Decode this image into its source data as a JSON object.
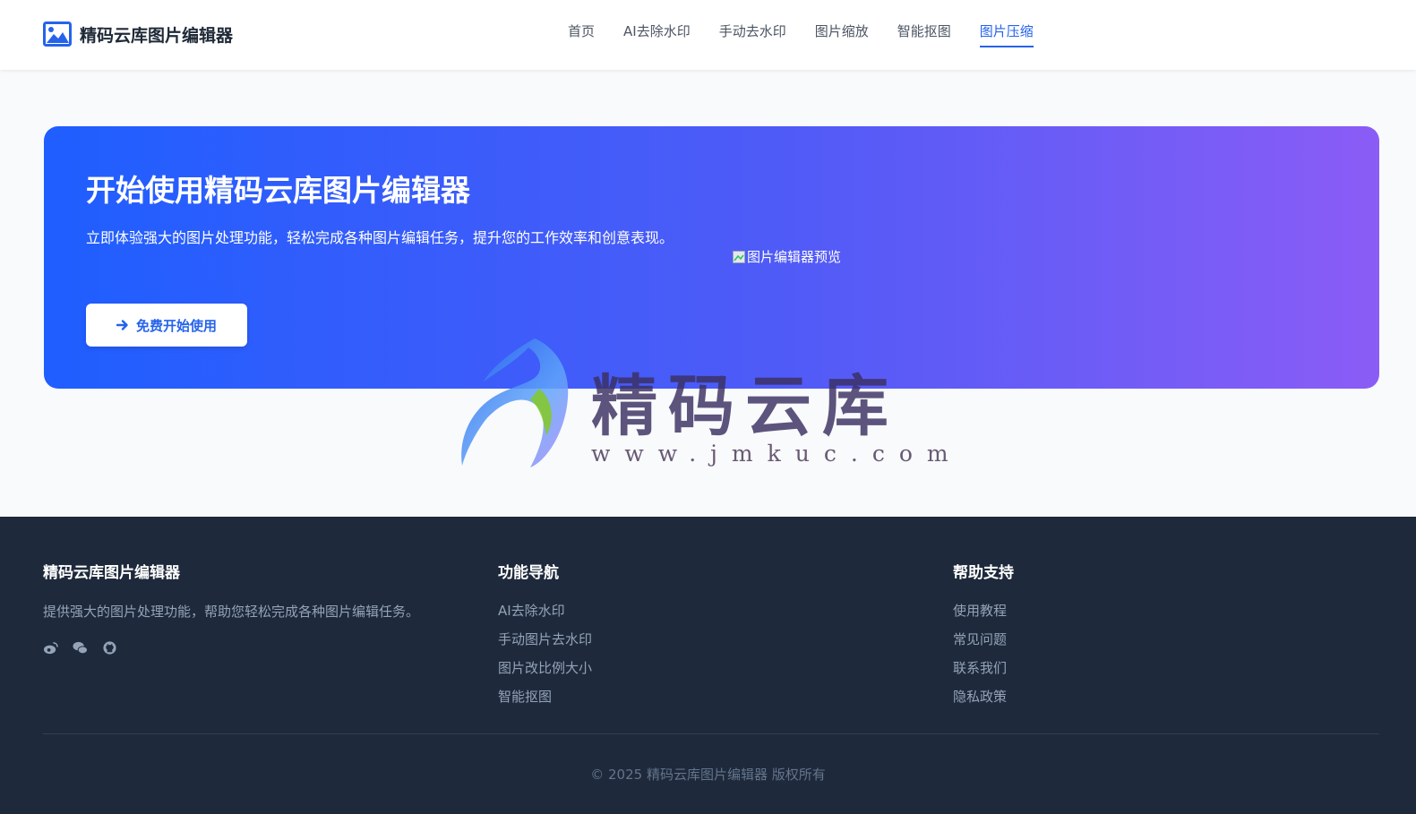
{
  "header": {
    "brand_name": "精码云库图片编辑器",
    "nav": [
      {
        "label": "首页",
        "active": false
      },
      {
        "label": "AI去除水印",
        "active": false
      },
      {
        "label": "手动去水印",
        "active": false
      },
      {
        "label": "图片缩放",
        "active": false
      },
      {
        "label": "智能抠图",
        "active": false
      },
      {
        "label": "图片压缩",
        "active": true
      }
    ]
  },
  "hero": {
    "title": "开始使用精码云库图片编辑器",
    "description": "立即体验强大的图片处理功能，轻松完成各种图片编辑任务，提升您的工作效率和创意表现。",
    "cta_label": "免费开始使用",
    "preview_alt": "图片编辑器预览"
  },
  "watermark": {
    "text": "精码云库",
    "url": "www.jmkuc.com"
  },
  "footer": {
    "about": {
      "title": "精码云库图片编辑器",
      "description": "提供强大的图片处理功能，帮助您轻松完成各种图片编辑任务。",
      "socials": [
        "weibo-icon",
        "wechat-icon",
        "github-icon"
      ]
    },
    "nav": {
      "title": "功能导航",
      "links": [
        "AI去除水印",
        "手动图片去水印",
        "图片改比例大小",
        "智能抠图"
      ]
    },
    "help": {
      "title": "帮助支持",
      "links": [
        "使用教程",
        "常见问题",
        "联系我们",
        "隐私政策"
      ]
    },
    "copyright": "© 2025 精码云库图片编辑器 版权所有"
  },
  "colors": {
    "accent": "#2563eb",
    "hero_start": "#1f5eff",
    "hero_end": "#8b5cf6",
    "footer_bg": "#1e293b"
  }
}
